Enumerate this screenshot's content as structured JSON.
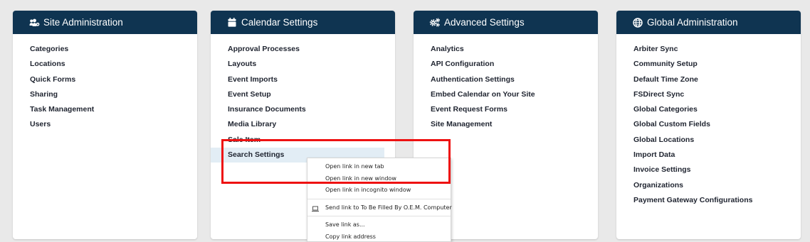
{
  "colors": {
    "page_background": "#e9e9e9",
    "card_header": "#0f3451",
    "highlight_box": "#ee1111",
    "hover_row": "#e2edf5"
  },
  "cards": [
    {
      "title": "Site Administration",
      "icon": "users-cog-icon",
      "items": [
        "Categories",
        "Locations",
        "Quick Forms",
        "Sharing",
        "Task Management",
        "Users"
      ]
    },
    {
      "title": "Calendar Settings",
      "icon": "calendar-icon",
      "items": [
        "Approval Processes",
        "Layouts",
        "Event Imports",
        "Event Setup",
        "Insurance Documents",
        "Media Library",
        "Sale Item",
        "Search Settings"
      ],
      "hovered_item": "Search Settings"
    },
    {
      "title": "Advanced Settings",
      "icon": "cogs-icon",
      "items": [
        "Analytics",
        "API Configuration",
        "Authentication Settings",
        "Embed Calendar on Your Site",
        "Event Request Forms",
        "Site Management"
      ]
    },
    {
      "title": "Global Administration",
      "icon": "globe-icon",
      "items": [
        "Arbiter Sync",
        "Community Setup",
        "Default Time Zone",
        "FSDirect Sync",
        "Global Categories",
        "Global Custom Fields",
        "Global Locations",
        "Import Data",
        "Invoice Settings",
        "Organizations",
        "Payment Gateway Configurations"
      ]
    }
  ],
  "context_menu": {
    "items": [
      "Open link in new tab",
      "Open link in new window",
      "Open link in incognito window",
      "Send link to To Be Filled By O.E.M. Computer",
      "Save link as...",
      "Copy link address"
    ],
    "send_icon": "laptop-icon"
  }
}
